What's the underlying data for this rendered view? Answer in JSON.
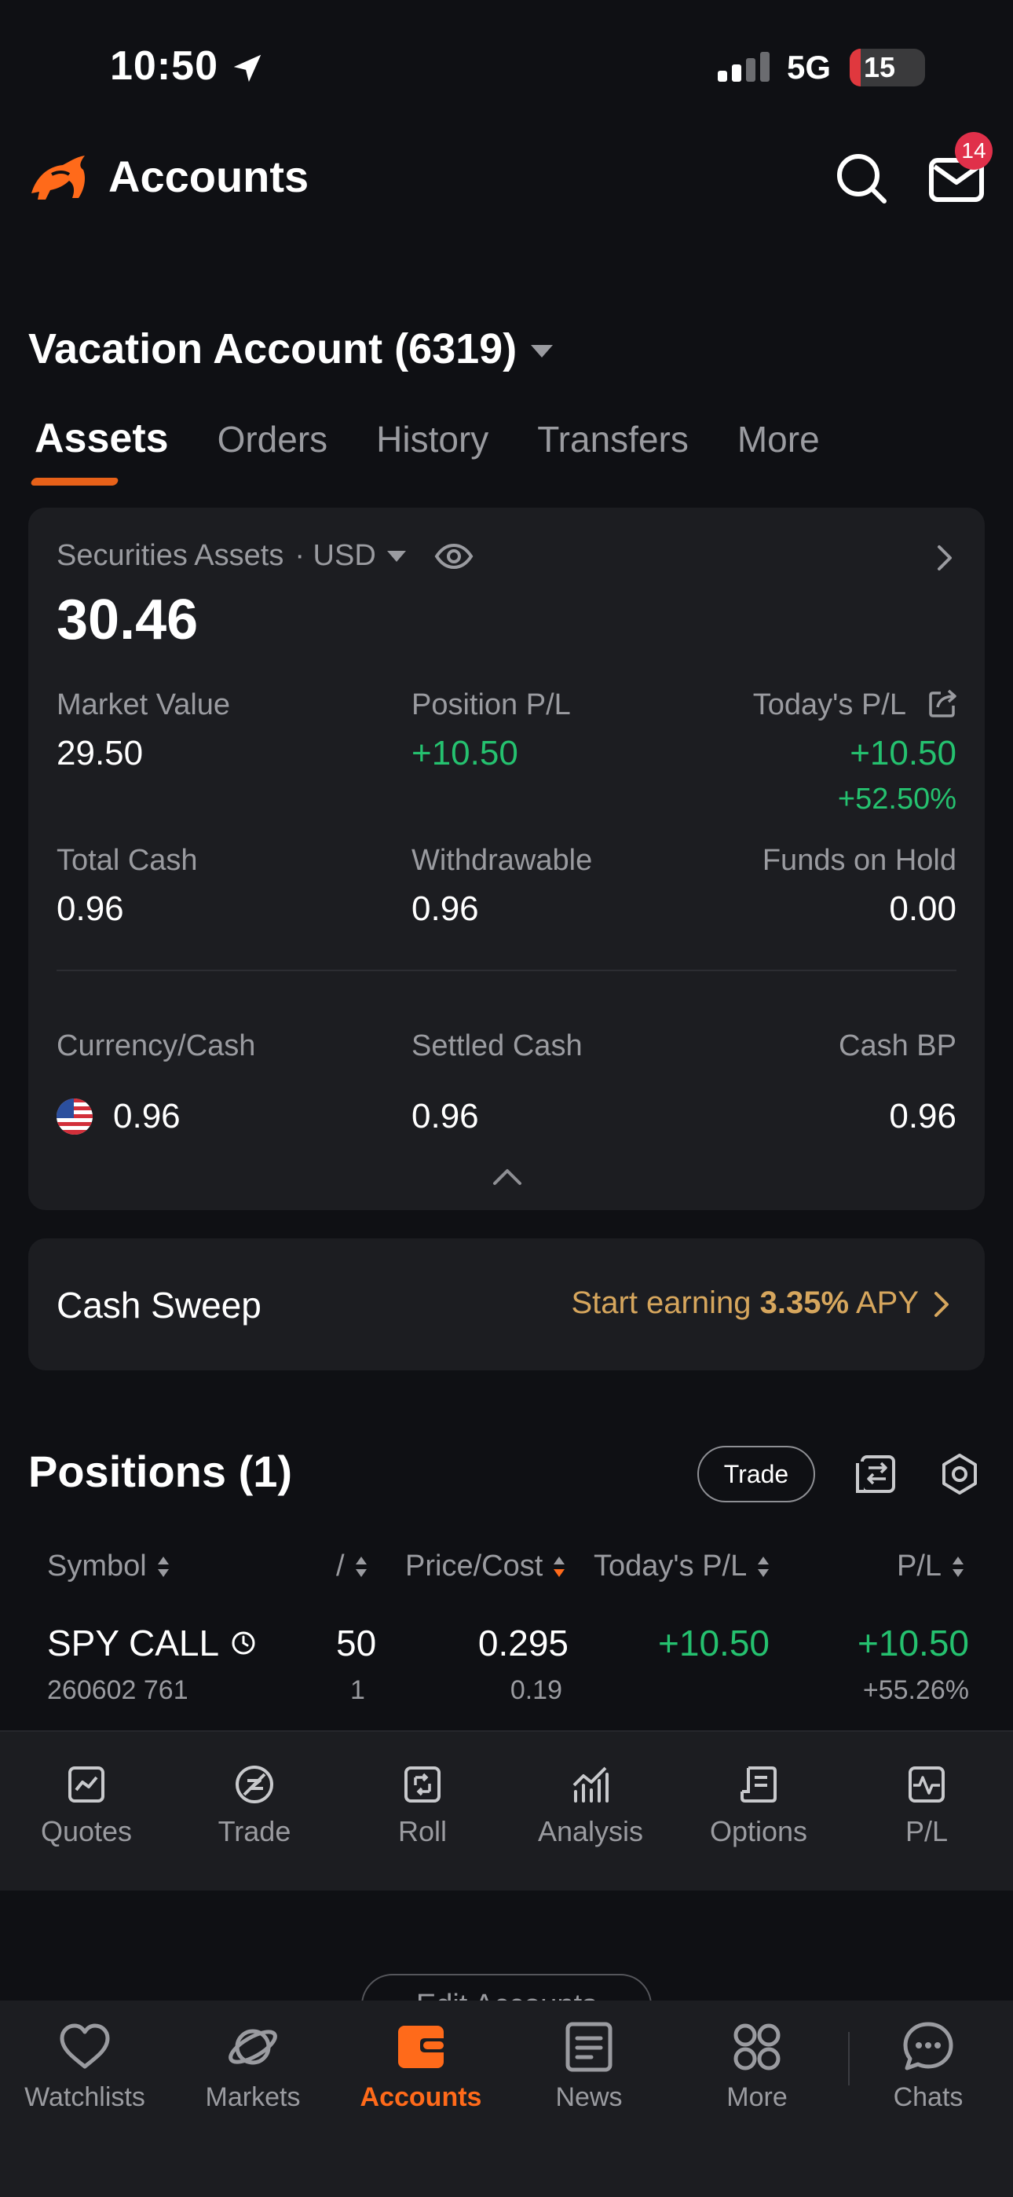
{
  "status": {
    "time": "10:50",
    "network": "5G",
    "battery": "15"
  },
  "header": {
    "title": "Accounts",
    "mail_badge": "14"
  },
  "account": {
    "name": "Vacation Account (6319)"
  },
  "tabs": [
    "Assets",
    "Orders",
    "History",
    "Transfers",
    "More"
  ],
  "assets": {
    "label": "Securities Assets",
    "currency": "· USD",
    "total": "30.46",
    "market_value_label": "Market Value",
    "market_value": "29.50",
    "position_pl_label": "Position P/L",
    "position_pl": "+10.50",
    "todays_pl_label": "Today's P/L",
    "todays_pl": "+10.50",
    "todays_pl_pct": "+52.50%",
    "total_cash_label": "Total Cash",
    "total_cash": "0.96",
    "withdrawable_label": "Withdrawable",
    "withdrawable": "0.96",
    "funds_on_hold_label": "Funds on Hold",
    "funds_on_hold": "0.00",
    "currency_cash_label": "Currency/Cash",
    "currency_cash": "0.96",
    "settled_cash_label": "Settled Cash",
    "settled_cash": "0.96",
    "cash_bp_label": "Cash BP",
    "cash_bp": "0.96"
  },
  "cash_sweep": {
    "label": "Cash Sweep",
    "cta_prefix": "Start earning",
    "apy_value": "3.35%",
    "cta_suffix": "APY"
  },
  "positions": {
    "title": "Positions (1)",
    "trade_label": "Trade",
    "columns": {
      "symbol": "Symbol",
      "qty": "/",
      "price_cost": "Price/Cost",
      "todays_pl": "Today's P/L",
      "pl": "P/L"
    },
    "rows": [
      {
        "symbol": "SPY CALL",
        "contract": "260602 761",
        "value": "50",
        "qty": "1",
        "price": "0.295",
        "cost": "0.19",
        "todays_pl": "+10.50",
        "pl": "+10.50",
        "pl_pct": "+55.26%"
      }
    ]
  },
  "actions": [
    "Quotes",
    "Trade",
    "Roll",
    "Analysis",
    "Options",
    "P/L"
  ],
  "edit_accounts": "Edit Accounts",
  "nav": [
    "Watchlists",
    "Markets",
    "Accounts",
    "News",
    "More",
    "Chats"
  ],
  "colors": {
    "accent": "#ff6a1a",
    "gain": "#25c16f",
    "gold": "#d6a65d",
    "background": "#0f1014",
    "card": "#1c1d21"
  }
}
